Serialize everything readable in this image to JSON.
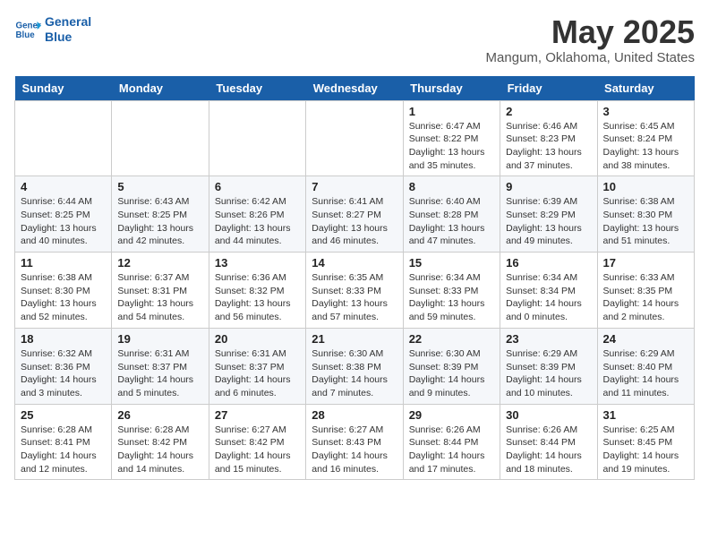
{
  "header": {
    "logo_line1": "General",
    "logo_line2": "Blue",
    "month": "May 2025",
    "location": "Mangum, Oklahoma, United States"
  },
  "days_of_week": [
    "Sunday",
    "Monday",
    "Tuesday",
    "Wednesday",
    "Thursday",
    "Friday",
    "Saturday"
  ],
  "weeks": [
    [
      {
        "day": "",
        "info": ""
      },
      {
        "day": "",
        "info": ""
      },
      {
        "day": "",
        "info": ""
      },
      {
        "day": "",
        "info": ""
      },
      {
        "day": "1",
        "info": "Sunrise: 6:47 AM\nSunset: 8:22 PM\nDaylight: 13 hours\nand 35 minutes."
      },
      {
        "day": "2",
        "info": "Sunrise: 6:46 AM\nSunset: 8:23 PM\nDaylight: 13 hours\nand 37 minutes."
      },
      {
        "day": "3",
        "info": "Sunrise: 6:45 AM\nSunset: 8:24 PM\nDaylight: 13 hours\nand 38 minutes."
      }
    ],
    [
      {
        "day": "4",
        "info": "Sunrise: 6:44 AM\nSunset: 8:25 PM\nDaylight: 13 hours\nand 40 minutes."
      },
      {
        "day": "5",
        "info": "Sunrise: 6:43 AM\nSunset: 8:25 PM\nDaylight: 13 hours\nand 42 minutes."
      },
      {
        "day": "6",
        "info": "Sunrise: 6:42 AM\nSunset: 8:26 PM\nDaylight: 13 hours\nand 44 minutes."
      },
      {
        "day": "7",
        "info": "Sunrise: 6:41 AM\nSunset: 8:27 PM\nDaylight: 13 hours\nand 46 minutes."
      },
      {
        "day": "8",
        "info": "Sunrise: 6:40 AM\nSunset: 8:28 PM\nDaylight: 13 hours\nand 47 minutes."
      },
      {
        "day": "9",
        "info": "Sunrise: 6:39 AM\nSunset: 8:29 PM\nDaylight: 13 hours\nand 49 minutes."
      },
      {
        "day": "10",
        "info": "Sunrise: 6:38 AM\nSunset: 8:30 PM\nDaylight: 13 hours\nand 51 minutes."
      }
    ],
    [
      {
        "day": "11",
        "info": "Sunrise: 6:38 AM\nSunset: 8:30 PM\nDaylight: 13 hours\nand 52 minutes."
      },
      {
        "day": "12",
        "info": "Sunrise: 6:37 AM\nSunset: 8:31 PM\nDaylight: 13 hours\nand 54 minutes."
      },
      {
        "day": "13",
        "info": "Sunrise: 6:36 AM\nSunset: 8:32 PM\nDaylight: 13 hours\nand 56 minutes."
      },
      {
        "day": "14",
        "info": "Sunrise: 6:35 AM\nSunset: 8:33 PM\nDaylight: 13 hours\nand 57 minutes."
      },
      {
        "day": "15",
        "info": "Sunrise: 6:34 AM\nSunset: 8:33 PM\nDaylight: 13 hours\nand 59 minutes."
      },
      {
        "day": "16",
        "info": "Sunrise: 6:34 AM\nSunset: 8:34 PM\nDaylight: 14 hours\nand 0 minutes."
      },
      {
        "day": "17",
        "info": "Sunrise: 6:33 AM\nSunset: 8:35 PM\nDaylight: 14 hours\nand 2 minutes."
      }
    ],
    [
      {
        "day": "18",
        "info": "Sunrise: 6:32 AM\nSunset: 8:36 PM\nDaylight: 14 hours\nand 3 minutes."
      },
      {
        "day": "19",
        "info": "Sunrise: 6:31 AM\nSunset: 8:37 PM\nDaylight: 14 hours\nand 5 minutes."
      },
      {
        "day": "20",
        "info": "Sunrise: 6:31 AM\nSunset: 8:37 PM\nDaylight: 14 hours\nand 6 minutes."
      },
      {
        "day": "21",
        "info": "Sunrise: 6:30 AM\nSunset: 8:38 PM\nDaylight: 14 hours\nand 7 minutes."
      },
      {
        "day": "22",
        "info": "Sunrise: 6:30 AM\nSunset: 8:39 PM\nDaylight: 14 hours\nand 9 minutes."
      },
      {
        "day": "23",
        "info": "Sunrise: 6:29 AM\nSunset: 8:39 PM\nDaylight: 14 hours\nand 10 minutes."
      },
      {
        "day": "24",
        "info": "Sunrise: 6:29 AM\nSunset: 8:40 PM\nDaylight: 14 hours\nand 11 minutes."
      }
    ],
    [
      {
        "day": "25",
        "info": "Sunrise: 6:28 AM\nSunset: 8:41 PM\nDaylight: 14 hours\nand 12 minutes."
      },
      {
        "day": "26",
        "info": "Sunrise: 6:28 AM\nSunset: 8:42 PM\nDaylight: 14 hours\nand 14 minutes."
      },
      {
        "day": "27",
        "info": "Sunrise: 6:27 AM\nSunset: 8:42 PM\nDaylight: 14 hours\nand 15 minutes."
      },
      {
        "day": "28",
        "info": "Sunrise: 6:27 AM\nSunset: 8:43 PM\nDaylight: 14 hours\nand 16 minutes."
      },
      {
        "day": "29",
        "info": "Sunrise: 6:26 AM\nSunset: 8:44 PM\nDaylight: 14 hours\nand 17 minutes."
      },
      {
        "day": "30",
        "info": "Sunrise: 6:26 AM\nSunset: 8:44 PM\nDaylight: 14 hours\nand 18 minutes."
      },
      {
        "day": "31",
        "info": "Sunrise: 6:25 AM\nSunset: 8:45 PM\nDaylight: 14 hours\nand 19 minutes."
      }
    ]
  ]
}
